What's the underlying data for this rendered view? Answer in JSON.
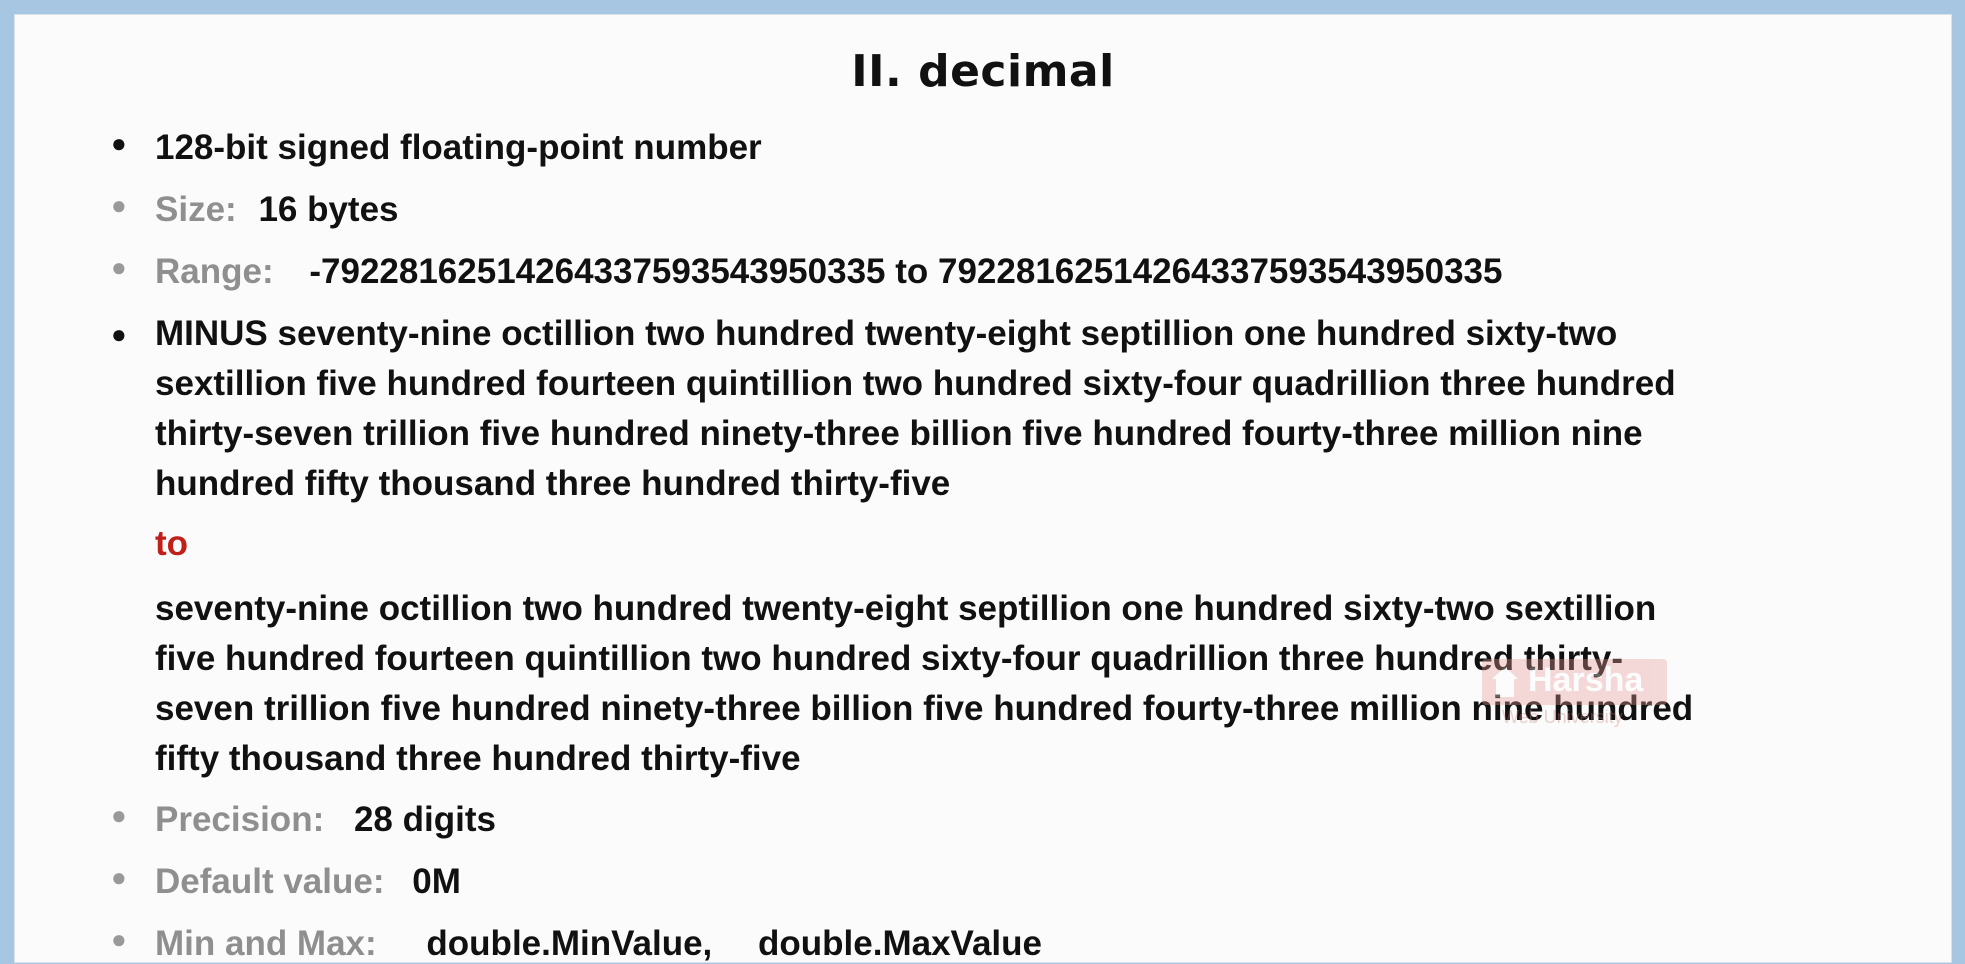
{
  "title": "II. decimal",
  "items": {
    "description": "128-bit signed floating-point number",
    "size_label": "Size:",
    "size_value": "16 bytes",
    "range_label": "Range:",
    "range_value": "-79228162514264337593543950335 to 79228162514264337593543950335",
    "minus_lines": [
      "MINUS seventy-nine octillion two hundred twenty-eight septillion one hundred sixty-two",
      "sextillion five hundred fourteen quintillion two hundred sixty-four quadrillion three hundred",
      "thirty-seven trillion five hundred ninety-three billion five hundred fourty-three million nine",
      "hundred fifty thousand three hundred thirty-five"
    ],
    "to_word": "to",
    "plus_lines": [
      "seventy-nine octillion two hundred twenty-eight septillion one hundred sixty-two sextillion",
      "five hundred fourteen quintillion two hundred sixty-four quadrillion three hundred thirty-",
      "seven trillion five hundred ninety-three billion five hundred fourty-three million nine hundred",
      "fifty thousand three hundred thirty-five"
    ],
    "precision_label": "Precision:",
    "precision_value": "28 digits",
    "default_label": "Default value:",
    "default_value": "0M",
    "minmax_label": "Min and Max:",
    "min_value": "double.MinValue,",
    "max_value": "double.MaxValue"
  },
  "watermark": {
    "brand": "Harsha",
    "subtitle": "Web University"
  },
  "colors": {
    "background": "#a7c6e2",
    "slide": "#fbfbfb",
    "text": "#111111",
    "label": "#8f8f8f",
    "accent": "#c0201a"
  },
  "icons": {
    "bullet": "bullet-dot-icon",
    "watermark": "house-logo-icon"
  }
}
